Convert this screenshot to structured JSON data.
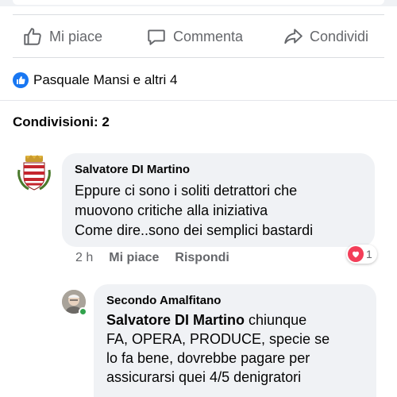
{
  "actions": {
    "like_label": "Mi piace",
    "comment_label": "Commenta",
    "share_label": "Condividi"
  },
  "reactions": {
    "summary": "Pasquale Mansi e altri 4"
  },
  "shares": {
    "label": "Condivisioni: 2"
  },
  "comments": [
    {
      "author": "Salvatore DI Martino",
      "lines": [
        "Eppure ci sono i soliti detrattori che",
        "muovono critiche alla iniziativa",
        "Come dire..sono dei semplici bastardi"
      ],
      "time": "2 h",
      "like_label": "Mi piace",
      "reply_label": "Rispondi",
      "reaction_count": "1"
    },
    {
      "author": "Secondo Amalfitano",
      "mention": "Salvatore DI Martino",
      "lines": [
        " chiunque",
        "FA, OPERA, PRODUCE, specie se",
        "lo fa bene, dovrebbe pagare per",
        "assicurarsi quei 4/5 denigratori"
      ]
    }
  ],
  "colors": {
    "accent": "#1877f2",
    "muted_text": "#65676b",
    "bubble_bg": "#f0f2f5",
    "heart": "#f33e58",
    "online": "#31a24c"
  }
}
